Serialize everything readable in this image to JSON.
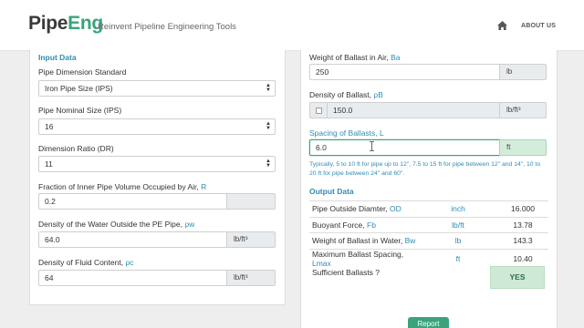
{
  "nav": {
    "brand_pipe": "Pipe",
    "brand_eng": "Eng",
    "tagline": "Reinvent Pipeline Engineering Tools",
    "home_icon": "home-icon",
    "about": "ABOUT US"
  },
  "input": {
    "title": "Input Data",
    "dimension_standard": {
      "label": "Pipe Dimension Standard",
      "value": "Iron Pipe Size (IPS)"
    },
    "nominal_size": {
      "label": "Pipe Nominal Size (IPS)",
      "value": "16"
    },
    "dr": {
      "label": "Dimension Ratio (DR)",
      "value": "11"
    },
    "air_fraction": {
      "label": "Fraction of Inner Pipe Volume Occupied by Air, ",
      "sym": "R",
      "value": "0.2"
    },
    "water_density": {
      "label": "Density of the Water Outside the PE Pipe, ",
      "sym": "ρw",
      "value": "64.0",
      "unit": "lb/ft³"
    },
    "fluid_density": {
      "label": "Density of Fluid Content, ",
      "sym": "ρc",
      "value": "64",
      "unit": "lb/ft³"
    }
  },
  "ballast": {
    "weight": {
      "label": "Weight of Ballast in Air, ",
      "sym": "Ba",
      "value": "250",
      "unit": "lb"
    },
    "density": {
      "label": "Density of Ballast, ",
      "sym": "ρB",
      "value": "150.0",
      "unit": "lb/ft³"
    },
    "spacing": {
      "label": "Spacing of Ballasts, L",
      "value": "6.0",
      "unit": "ft"
    },
    "hint": "Typically, 5 to 10 ft for pipe up to 12\", 7.5 to 15 ft for pipe between 12\" and 14\", 10 to 20 ft for pipe between 24\" and 60\"."
  },
  "output": {
    "title": "Output Data",
    "rows": [
      {
        "label": "Pipe Outside Diamter, ",
        "sym": "OD",
        "unit": "inch",
        "value": "16.000"
      },
      {
        "label": "Buoyant Force, ",
        "sym": "Fb",
        "unit": "lb/ft",
        "value": "13.78"
      },
      {
        "label": "Weight of Ballast in Water, ",
        "sym": "Bw",
        "unit": "lb",
        "value": "143.3"
      },
      {
        "label": "Maximum Ballast Spacing, ",
        "sym": "Lmax",
        "unit": "ft",
        "value": "10.40"
      }
    ],
    "sufficient_label": "Sufficient Ballasts ?",
    "sufficient_value": "YES"
  },
  "report_button": "Report",
  "colors": {
    "accent": "#3aa37c",
    "link": "#2f8cb3",
    "yes_bg": "#cfe9d7"
  }
}
